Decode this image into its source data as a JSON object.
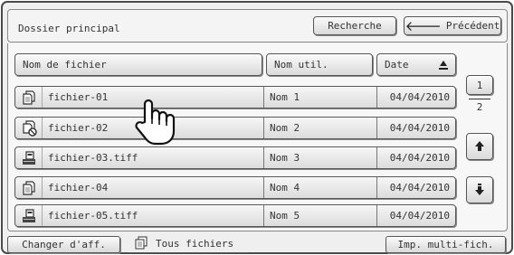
{
  "header": {
    "folder_title": "Dossier principal",
    "search_label": "Recherche",
    "previous_label": "Précédent"
  },
  "columns": {
    "name": "Nom de fichier",
    "user": "Nom util.",
    "date": "Date"
  },
  "files": [
    {
      "icon": "copy-document-icon",
      "name": "fichier-01",
      "user": "Nom 1",
      "date": "04/04/2010"
    },
    {
      "icon": "copy-document-prohibited-icon",
      "name": "fichier-02",
      "user": "Nom 2",
      "date": "04/04/2010"
    },
    {
      "icon": "scanned-image-icon",
      "name": "fichier-03.tiff",
      "user": "Nom 3",
      "date": "04/04/2010"
    },
    {
      "icon": "copy-document-icon",
      "name": "fichier-04",
      "user": "Nom 4",
      "date": "04/04/2010"
    },
    {
      "icon": "scanned-image-icon",
      "name": "fichier-05.tiff",
      "user": "Nom 5",
      "date": "04/04/2010"
    }
  ],
  "pager": {
    "current_page": "1",
    "total_pages": "2"
  },
  "footer": {
    "change_view_label": "Changer d'aff.",
    "all_files_label": "Tous fichiers",
    "multi_print_label": "Imp. multi-fich."
  }
}
